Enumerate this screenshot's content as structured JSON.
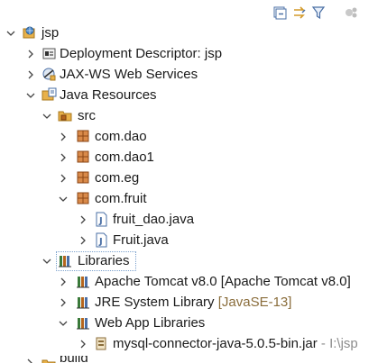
{
  "toolbar": {
    "icons": [
      "collapse-all-icon",
      "link-with-editor-icon",
      "filter-icon",
      "view-menu-icon"
    ]
  },
  "tree": {
    "root": {
      "label": "jsp",
      "expanded": true
    },
    "deployment_descriptor": {
      "label": "Deployment Descriptor: jsp"
    },
    "jaxws": {
      "label": "JAX-WS Web Services"
    },
    "java_resources": {
      "label": "Java Resources",
      "expanded": true
    },
    "src": {
      "label": "src",
      "expanded": true
    },
    "packages": [
      {
        "label": "com.dao"
      },
      {
        "label": "com.dao1"
      },
      {
        "label": "com.eg"
      },
      {
        "label": "com.fruit",
        "expanded": true
      }
    ],
    "files": [
      {
        "label": "fruit_dao.java"
      },
      {
        "label": "Fruit.java"
      }
    ],
    "libraries": {
      "label": "Libraries",
      "expanded": true,
      "selected": true
    },
    "apache_tomcat": {
      "label": "Apache Tomcat v8.0 [Apache Tomcat v8.0]"
    },
    "jre": {
      "label": "JRE System Library",
      "decoration": "[JavaSE-13]"
    },
    "web_app_libs": {
      "label": "Web App Libraries",
      "expanded": true
    },
    "mysql_jar": {
      "label": "mysql-connector-java-5.0.5-bin.jar",
      "decoration": " - I:\\jsp"
    },
    "build": {
      "label": "build"
    }
  },
  "colors": {
    "package_icon": "#b5651d",
    "folder_icon": "#e8b14a",
    "java_icon": "#4a6fa5",
    "selection_border": "#7da2ce",
    "decoration": "#8a6d3b"
  }
}
